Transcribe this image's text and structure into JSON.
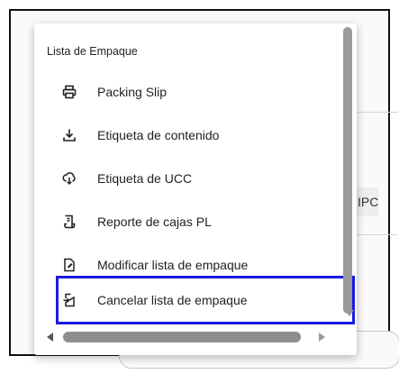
{
  "menu": {
    "title": "Lista de Empaque",
    "items": [
      {
        "label": "Packing Slip",
        "icon": "printer-icon"
      },
      {
        "label": "Etiqueta de contenido",
        "icon": "download-icon"
      },
      {
        "label": "Etiqueta de UCC",
        "icon": "cloud-download-icon"
      },
      {
        "label": "Reporte de cajas PL",
        "icon": "receipt-icon"
      },
      {
        "label": "Modificar lista de empaque",
        "icon": "edit-document-icon"
      },
      {
        "label": "Cancelar lista de empaque",
        "icon": "cancel-document-icon"
      }
    ]
  },
  "background": {
    "chip_text": "IPC"
  },
  "colors": {
    "highlight": "#1a1ae6",
    "scrollbar": "#9a9a9a"
  }
}
